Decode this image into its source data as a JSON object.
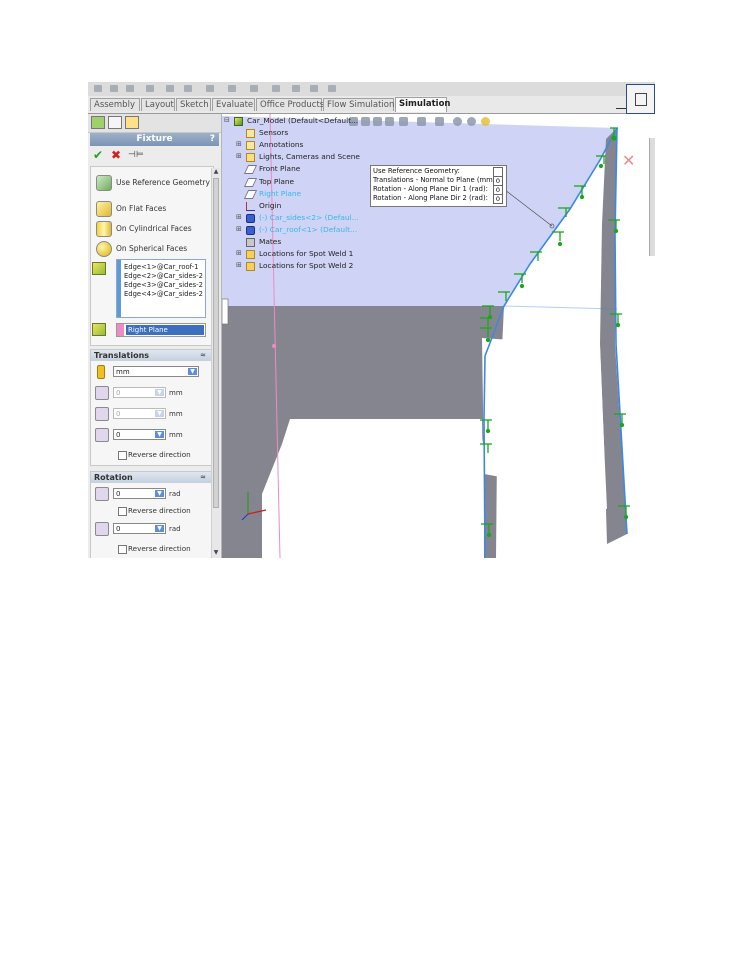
{
  "tabs": [
    "Assembly",
    "Layout",
    "Sketch",
    "Evaluate",
    "Office Products",
    "Flow Simulation",
    "Simulation"
  ],
  "active_tab": "Simulation",
  "property_manager": {
    "title": "Fixture",
    "help": "?",
    "options": [
      {
        "label": "Use Reference Geometry",
        "icon": "reference-geometry-icon"
      },
      {
        "label": "On Flat Faces",
        "icon": "flat-faces-icon"
      },
      {
        "label": "On Cylindrical Faces",
        "icon": "cylindrical-faces-icon"
      },
      {
        "label": "On Spherical Faces",
        "icon": "spherical-faces-icon"
      }
    ],
    "edges": [
      "Edge<1>@Car_roof-1",
      "Edge<2>@Car_sides-2",
      "Edge<3>@Car_sides-2",
      "Edge<4>@Car_sides-2"
    ],
    "reference_plane": "Right Plane",
    "translations": {
      "title": "Translations",
      "unit": "mm",
      "values": [
        "0",
        "0",
        "0"
      ],
      "unit_label": "mm",
      "reverse": "Reverse direction"
    },
    "rotation": {
      "title": "Rotation",
      "values": [
        "0",
        "0"
      ],
      "unit_label": "rad",
      "reverse": "Reverse direction"
    }
  },
  "tree": [
    {
      "label": "Car_Model  (Default<Default...",
      "expander": "⊟",
      "color": "normal",
      "icon": "assembly-icon"
    },
    {
      "label": "Sensors",
      "expander": "",
      "color": "normal",
      "icon": "sensor-icon"
    },
    {
      "label": "Annotations",
      "expander": "⊞",
      "color": "normal",
      "icon": "annotation-icon"
    },
    {
      "label": "Lights, Cameras and Scene",
      "expander": "⊞",
      "color": "normal",
      "icon": "lights-icon"
    },
    {
      "label": "Front Plane",
      "expander": "",
      "color": "normal",
      "icon": "plane-icon"
    },
    {
      "label": "Top Plane",
      "expander": "",
      "color": "normal",
      "icon": "plane-icon"
    },
    {
      "label": "Right Plane",
      "expander": "",
      "color": "blue",
      "icon": "plane-icon"
    },
    {
      "label": "Origin",
      "expander": "",
      "color": "normal",
      "icon": "origin-icon"
    },
    {
      "label": "(-) Car_sides<2> (Defaul...",
      "expander": "⊞",
      "color": "blue",
      "icon": "part-icon"
    },
    {
      "label": "(-) Car_roof<1> (Default...",
      "expander": "⊞",
      "color": "blue",
      "icon": "part-icon"
    },
    {
      "label": "Mates",
      "expander": "",
      "color": "normal",
      "icon": "mates-icon"
    },
    {
      "label": "Locations for Spot Weld 1",
      "expander": "⊞",
      "color": "normal",
      "icon": "folder-icon"
    },
    {
      "label": "Locations for Spot Weld 2",
      "expander": "⊞",
      "color": "normal",
      "icon": "folder-icon"
    }
  ],
  "reference_callout": {
    "rows": [
      {
        "label": "Use Reference Geometry:",
        "value": ""
      },
      {
        "label": "Translations - Normal to Plane (mm):",
        "value": "0"
      },
      {
        "label": "Rotation - Along Plane Dir 1 (rad):",
        "value": "0"
      },
      {
        "label": "Rotation - Along Plane Dir 2 (rad):",
        "value": "0"
      }
    ]
  },
  "colors": {
    "fixture_green": "#1aa81a",
    "model_gray": "#85858f",
    "roof_lavender": "#cfd3f6",
    "edge_blue": "#3c88e4",
    "plane_pink": "#ee8ac4"
  }
}
